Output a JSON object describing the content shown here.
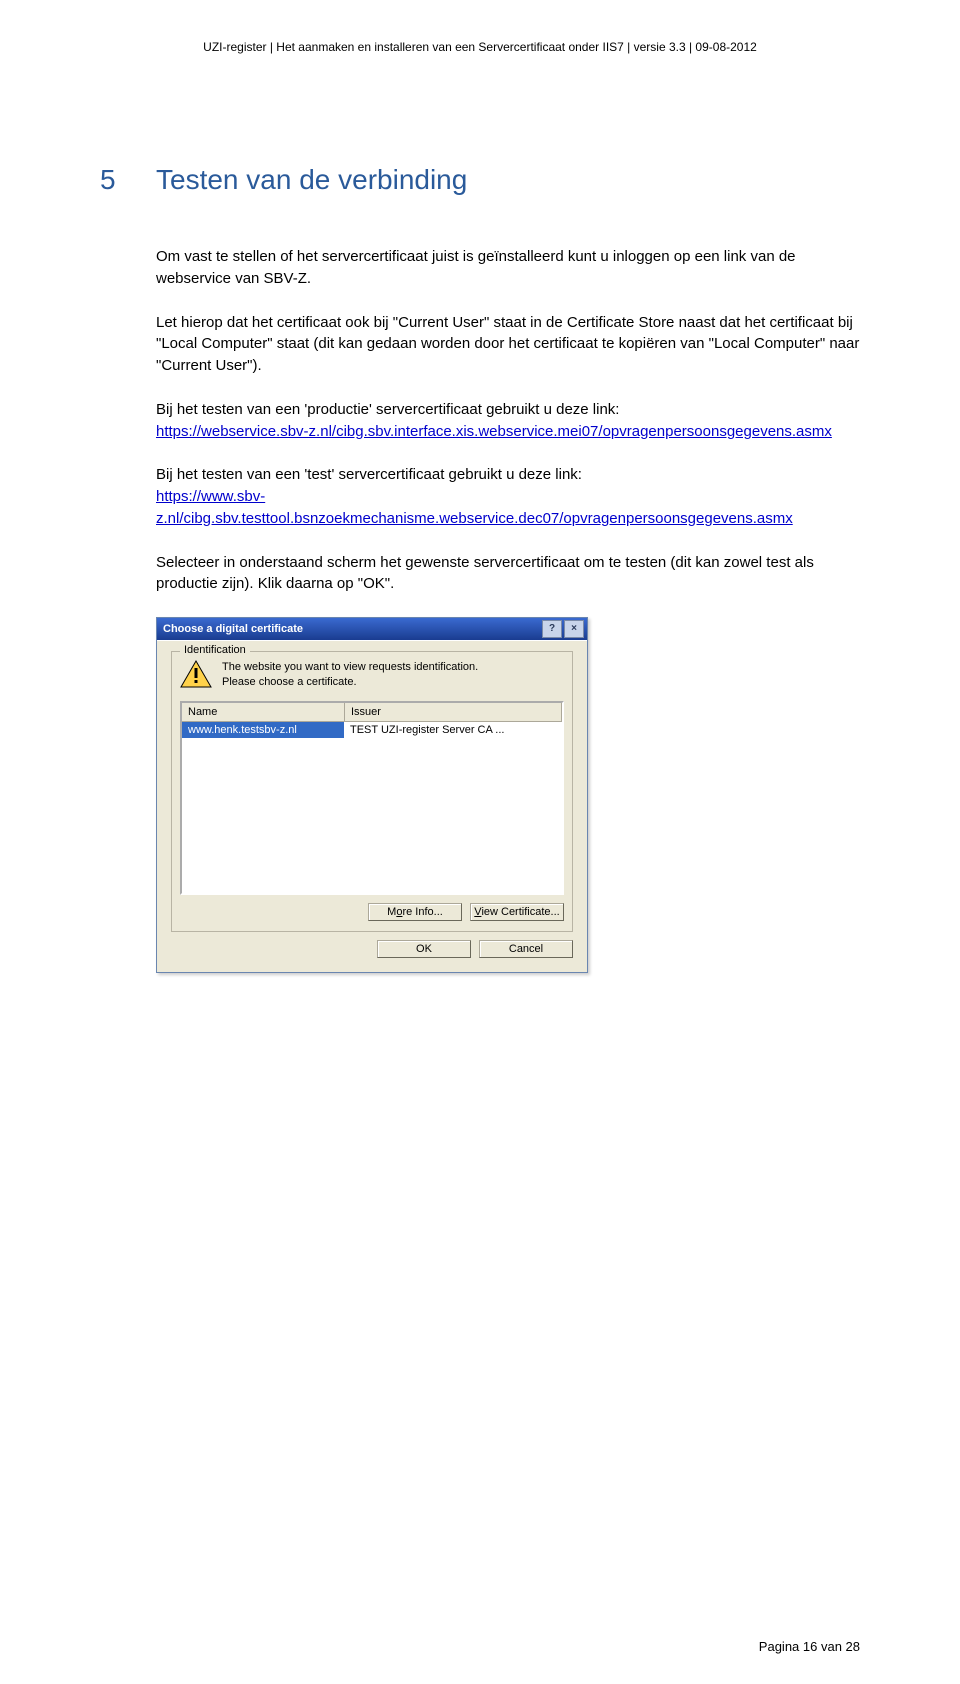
{
  "header": "UZI-register | Het aanmaken en installeren van een Servercertificaat onder IIS7 | versie 3.3 | 09-08-2012",
  "section": {
    "num": "5",
    "title": "Testen van de verbinding"
  },
  "p1": "Om vast te stellen of het servercertificaat juist is geïnstalleerd kunt u inloggen op een link van de webservice van SBV-Z.",
  "p2": "Let hierop dat het certificaat ook bij \"Current User\" staat in de Certificate Store naast dat het certificaat bij \"Local Computer\" staat (dit kan gedaan worden door het certificaat te kopiëren van \"Local Computer\" naar \"Current User\").",
  "p3_intro": "Bij het testen van een 'productie' servercertificaat gebruikt u deze link:",
  "p3_link": "https://webservice.sbv-z.nl/cibg.sbv.interface.xis.webservice.mei07/opvragenpersoonsgegevens.asmx",
  "p4_intro": "Bij het testen van een 'test' servercertificaat gebruikt u deze link:",
  "p4_link": "https://www.sbv-z.nl/cibg.sbv.testtool.bsnzoekmechanisme.webservice.dec07/opvragenpersoonsgegevens.asmx",
  "p5": "Selecteer in onderstaand scherm het gewenste servercertificaat om te testen (dit kan zowel test als productie zijn). Klik daarna op \"OK\".",
  "dialog": {
    "title": "Choose a digital certificate",
    "help": "?",
    "close": "×",
    "group": "Identification",
    "msg1": "The website you want to view requests identification.",
    "msg2": "Please choose a certificate.",
    "col_name": "Name",
    "col_issuer": "Issuer",
    "row_name": "www.henk.testsbv-z.nl",
    "row_issuer": "TEST UZI-register Server CA ...",
    "more_pre": "M",
    "more_u": "o",
    "more_post": "re Info...",
    "view_u": "V",
    "view_post": "iew Certificate...",
    "ok": "OK",
    "cancel": "Cancel"
  },
  "footer": "Pagina 16 van 28"
}
